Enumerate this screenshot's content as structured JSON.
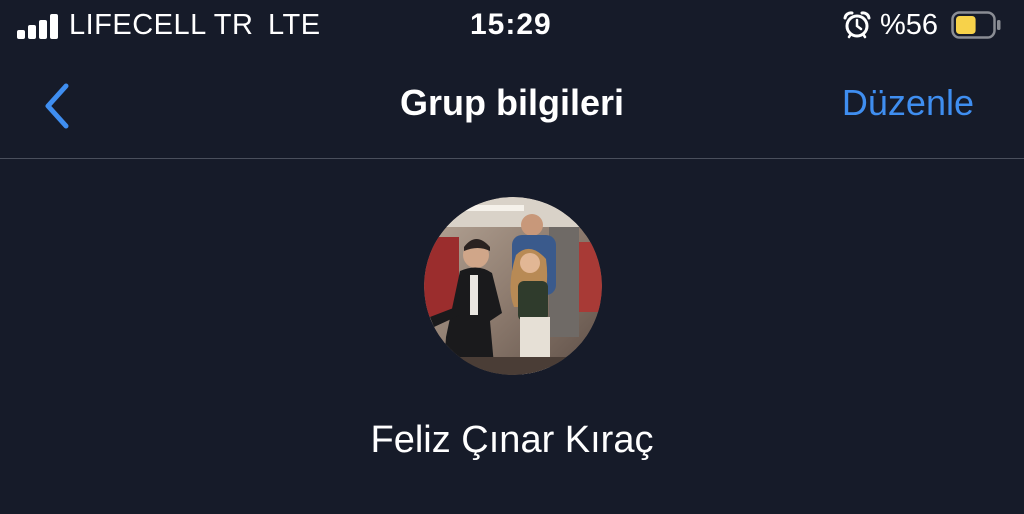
{
  "status_bar": {
    "carrier": "LIFECELL TR",
    "network": "LTE",
    "time": "15:29",
    "battery_text": "%56",
    "battery_level": 0.56,
    "icons": [
      "signal-bars-icon",
      "alarm-clock-icon",
      "battery-icon"
    ]
  },
  "nav": {
    "back_icon": "chevron-left-icon",
    "title": "Grup bilgileri",
    "edit_label": "Düzenle"
  },
  "group": {
    "name": "Feliz Çınar Kıraç"
  },
  "colors": {
    "background": "#161b29",
    "accent": "#3f8ef0",
    "battery_fill": "#f7d24a",
    "divider": "#4a4f5c"
  }
}
